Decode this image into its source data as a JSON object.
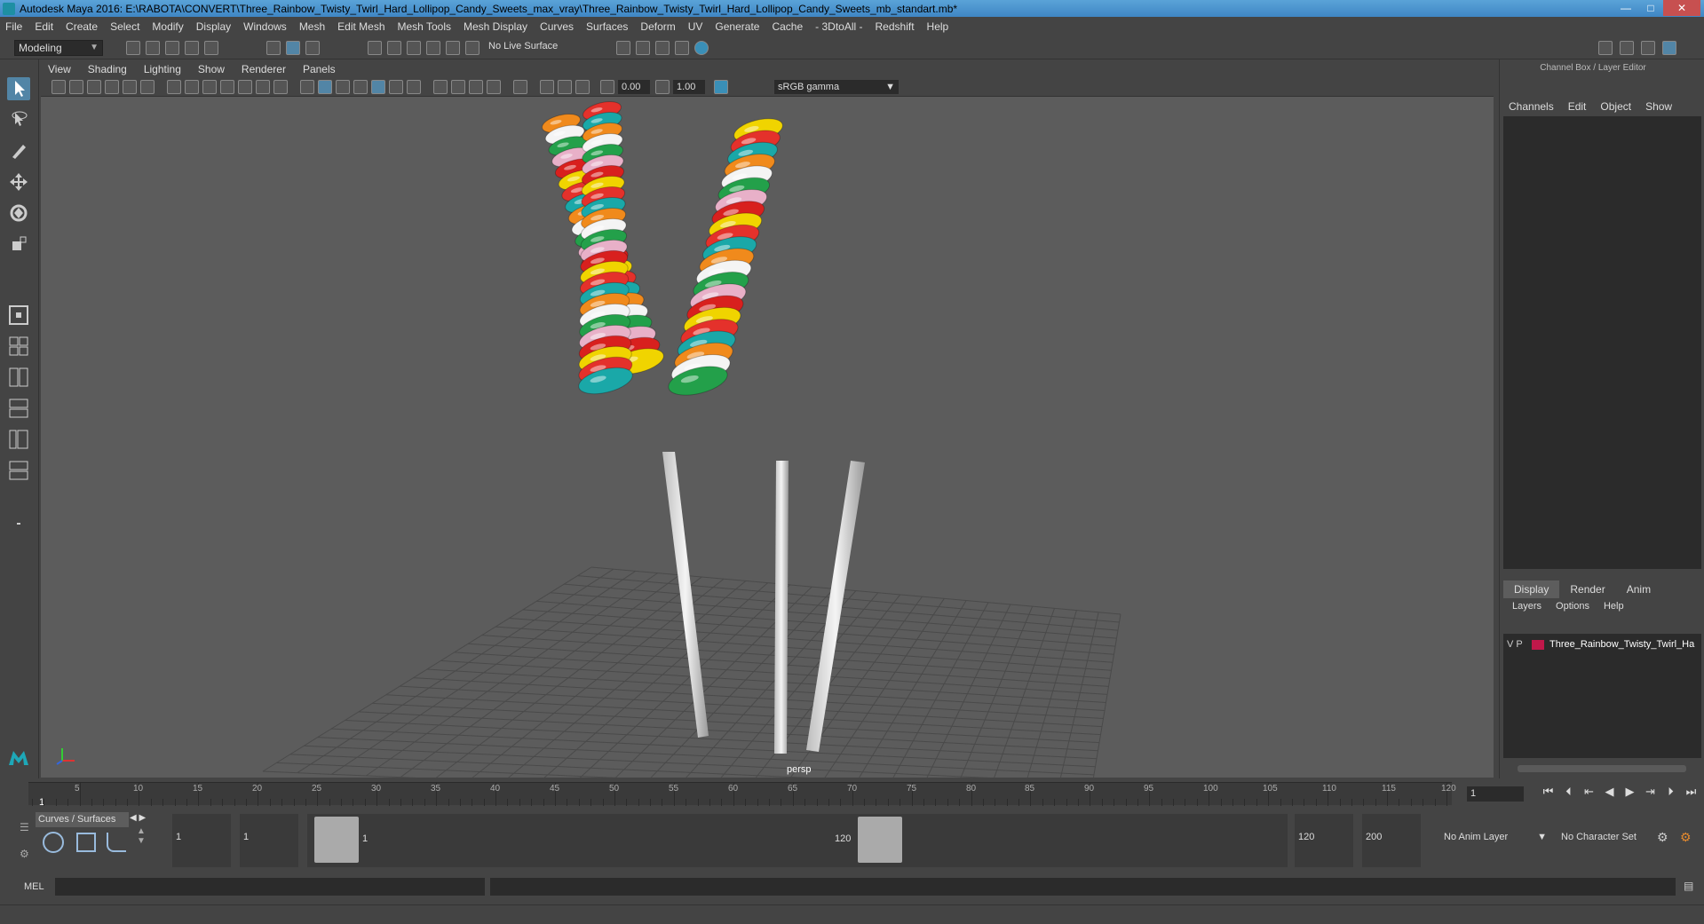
{
  "window": {
    "title": "Autodesk Maya 2016: E:\\RABOTA\\CONVERT\\Three_Rainbow_Twisty_Twirl_Hard_Lollipop_Candy_Sweets_max_vray\\Three_Rainbow_Twisty_Twirl_Hard_Lollipop_Candy_Sweets_mb_standart.mb*",
    "minimize": "—",
    "maximize": "□",
    "close": "✕"
  },
  "menubar": [
    "File",
    "Edit",
    "Create",
    "Select",
    "Modify",
    "Display",
    "Windows",
    "Mesh",
    "Edit Mesh",
    "Mesh Tools",
    "Mesh Display",
    "Curves",
    "Surfaces",
    "Deform",
    "UV",
    "Generate",
    "Cache",
    "- 3DtoAll -",
    "Redshift",
    "Help"
  ],
  "shelf": {
    "mode": "Modeling",
    "live_surface": "No Live Surface"
  },
  "viewport": {
    "menus": [
      "View",
      "Shading",
      "Lighting",
      "Show",
      "Renderer",
      "Panels"
    ],
    "field1": "0.00",
    "field2": "1.00",
    "color_space": "sRGB gamma",
    "camera_label": "persp"
  },
  "channel_box": {
    "title": "Channel Box / Layer Editor",
    "menus": [
      "Channels",
      "Edit",
      "Object",
      "Show"
    ]
  },
  "layer_editor": {
    "tabs": [
      "Display",
      "Render",
      "Anim"
    ],
    "active_tab": "Display",
    "menus": [
      "Layers",
      "Options",
      "Help"
    ],
    "layer": {
      "v": "V",
      "p": "P",
      "name": "Three_Rainbow_Twisty_Twirl_Ha",
      "color": "#c0184a"
    }
  },
  "timeline": {
    "ticks": [
      "5",
      "10",
      "15",
      "20",
      "25",
      "30",
      "35",
      "40",
      "45",
      "50",
      "55",
      "60",
      "65",
      "70",
      "75",
      "80",
      "85",
      "90",
      "95",
      "100",
      "105",
      "110",
      "115",
      "120"
    ],
    "current_frame_marker": "1",
    "current_frame": "1"
  },
  "range": {
    "shelf_tab": "Curves / Surfaces",
    "start_frame": "1",
    "playback_start": "1",
    "range_start_label": "1",
    "range_end_label": "120",
    "playback_end": "120",
    "end_frame": "200",
    "anim_layer": "No Anim Layer",
    "character_set": "No Character Set"
  },
  "command_line": {
    "label": "MEL"
  }
}
